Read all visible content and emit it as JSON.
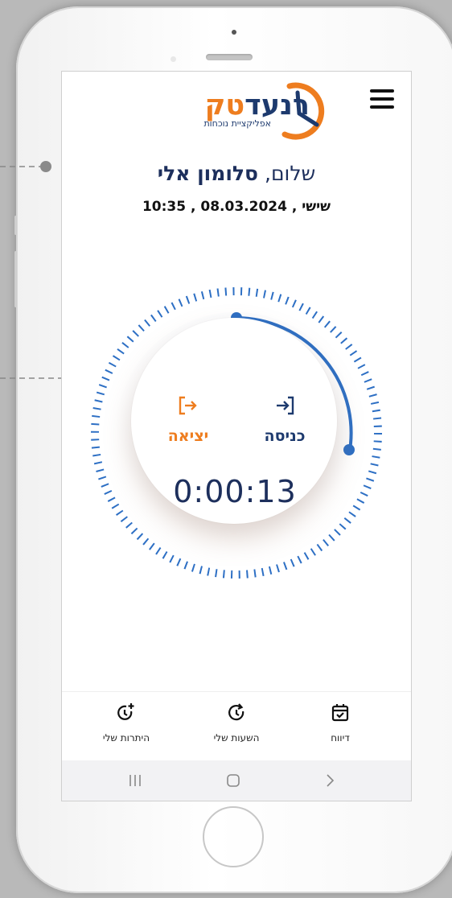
{
  "header": {
    "logo_text_blue": "רנעד",
    "logo_text_orange": "טק",
    "logo_subtitle": "אפליקציית נוכחות"
  },
  "greeting": {
    "prefix": "שלום,",
    "name": "סלומון אלי"
  },
  "datetime": "שישי , 08.03.2024 , 10:35",
  "clock": {
    "enter_label": "כניסה",
    "exit_label": "יציאה",
    "timer": "0:00:13"
  },
  "bottom_nav": [
    {
      "label": "היתרות שלי",
      "icon": "clock-plus-icon"
    },
    {
      "label": "השעות שלי",
      "icon": "clock-history-icon"
    },
    {
      "label": "דיווח",
      "icon": "calendar-check-icon"
    }
  ],
  "colors": {
    "brand_blue": "#1d3a6e",
    "brand_orange": "#ee7d1f",
    "dial_blue": "#2d6fc4"
  }
}
